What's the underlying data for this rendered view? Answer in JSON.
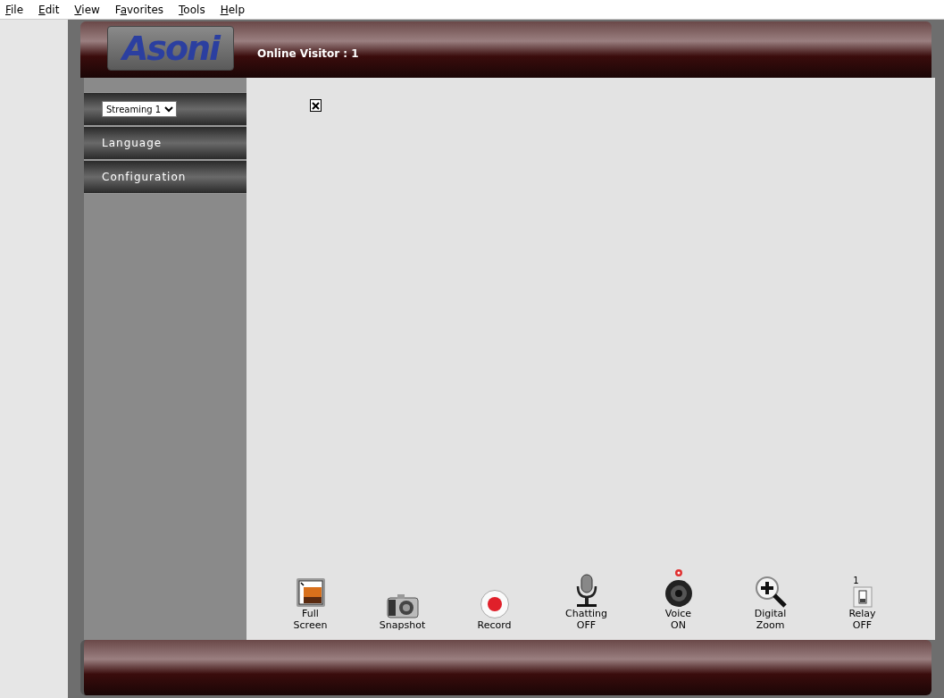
{
  "menu_bar": [
    {
      "key": "F",
      "rest": "ile"
    },
    {
      "key": "E",
      "rest": "dit"
    },
    {
      "key": "V",
      "rest": "iew"
    },
    {
      "lead": "F",
      "key": "a",
      "rest": "vorites"
    },
    {
      "key": "T",
      "rest": "ools"
    },
    {
      "key": "H",
      "rest": "elp"
    }
  ],
  "header": {
    "logo": "Asoni",
    "online_visitor": "Online Visitor : 1"
  },
  "sidebar": {
    "stream_select": "Streaming 1",
    "items": [
      {
        "label": "Language"
      },
      {
        "label": "Configuration"
      }
    ]
  },
  "toolbar": [
    {
      "kind": "fullscreen",
      "label": [
        "Full",
        "Screen"
      ]
    },
    {
      "kind": "snapshot",
      "label": [
        "Snapshot"
      ]
    },
    {
      "kind": "record",
      "label": [
        "Record"
      ]
    },
    {
      "kind": "mic",
      "label": [
        "Chatting",
        "OFF"
      ]
    },
    {
      "kind": "speaker",
      "label": [
        "Voice",
        "ON"
      ]
    },
    {
      "kind": "zoom",
      "label": [
        "Digital",
        "Zoom"
      ]
    },
    {
      "kind": "relay",
      "number": "1",
      "label": [
        "Relay",
        "OFF"
      ]
    }
  ]
}
